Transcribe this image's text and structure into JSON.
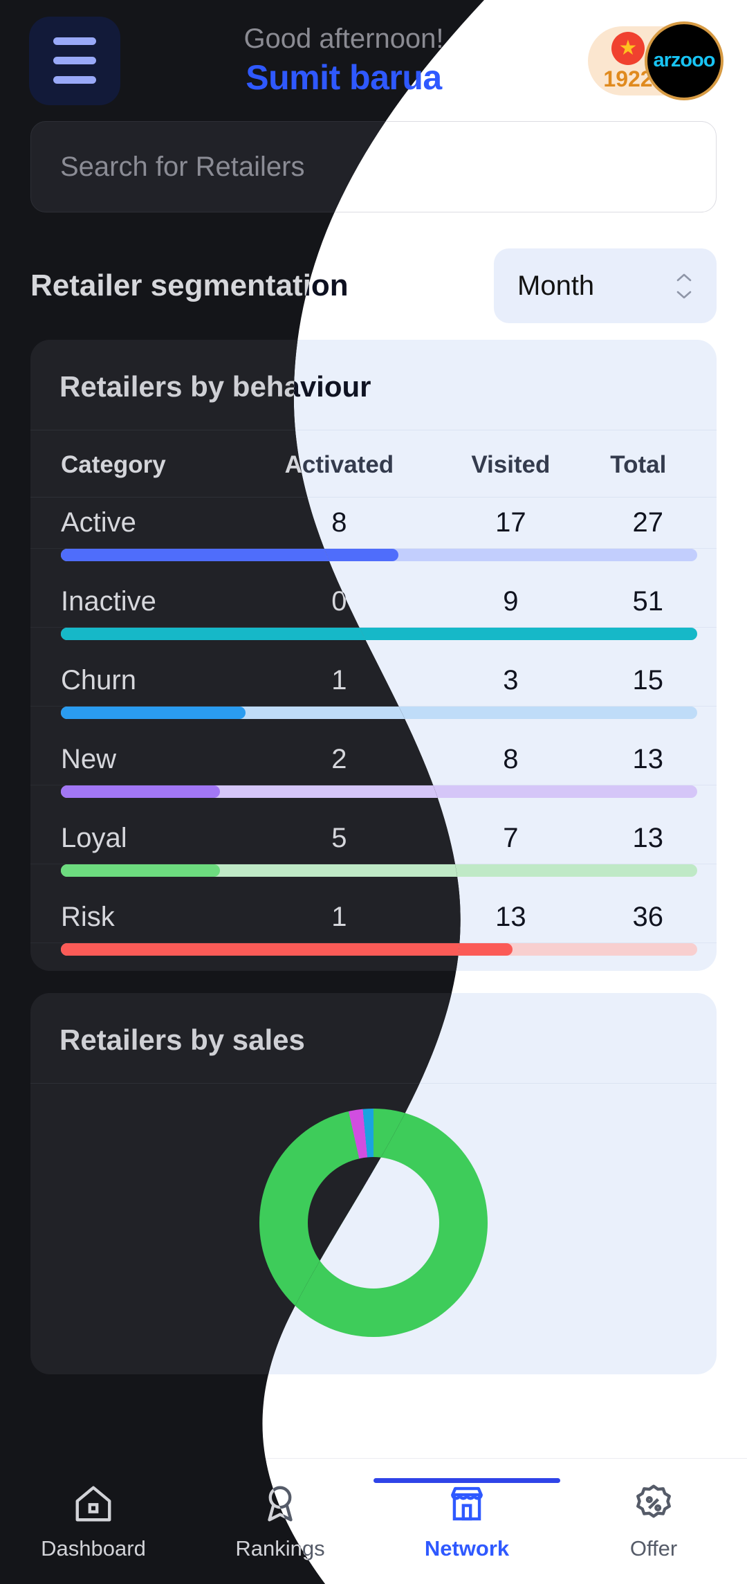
{
  "header": {
    "menu_icon": "hamburger-menu-icon",
    "greeting": "Good afternoon!",
    "user_name": "Sumit barua",
    "points": "1922",
    "star_icon": "star-icon",
    "avatar_text": "arzooo"
  },
  "search": {
    "placeholder": "Search for Retailers",
    "value": ""
  },
  "section": {
    "title": "Retailer segmentation",
    "period_selected": "Month",
    "period_icon": "chevron-up-down-icon"
  },
  "behaviour_card": {
    "title": "Retailers by behaviour"
  },
  "sales_card": {
    "title": "Retailers by sales"
  },
  "chart_data": [
    {
      "type": "table",
      "title": "Retailers by behaviour",
      "columns": [
        "Category",
        "Activated",
        "Visited",
        "Total"
      ],
      "rows": [
        {
          "category": "Active",
          "activated": 8,
          "visited": 17,
          "total": 27,
          "color": "#4f6dfb",
          "track": "#c2cefd"
        },
        {
          "category": "Inactive",
          "activated": 0,
          "visited": 9,
          "total": 51,
          "color": "#16b8c8",
          "track": "#b8e6ef"
        },
        {
          "category": "Churn",
          "activated": 1,
          "visited": 3,
          "total": 15,
          "color": "#2a9cf0",
          "track": "#bfdcf8"
        },
        {
          "category": "New",
          "activated": 2,
          "visited": 8,
          "total": 13,
          "color": "#a277f5",
          "track": "#d5c6f8"
        },
        {
          "category": "Loyal",
          "activated": 5,
          "visited": 7,
          "total": 13,
          "color": "#6ddc7f",
          "track": "#bfe9c6"
        },
        {
          "category": "Risk",
          "activated": 1,
          "visited": 13,
          "total": 36,
          "color": "#fb5b57",
          "track": "#f8cfcf"
        }
      ],
      "xlabel": "",
      "ylabel": ""
    },
    {
      "type": "pie",
      "title": "Retailers by sales",
      "labels": [
        "Green segment",
        "Magenta segment",
        "Cyan segment"
      ],
      "values": [
        96.5,
        2,
        1.5
      ],
      "colors": [
        "#3ecc5a",
        "#d14ee0",
        "#1aa3e0"
      ],
      "donut": true
    }
  ],
  "bottom_nav": {
    "items": [
      {
        "label": "Dashboard",
        "icon": "home-icon",
        "active": false
      },
      {
        "label": "Rankings",
        "icon": "medal-icon",
        "active": false
      },
      {
        "label": "Network",
        "icon": "store-icon",
        "active": true
      },
      {
        "label": "Offer",
        "icon": "discount-icon",
        "active": false
      }
    ]
  },
  "colors": {
    "accent_blue": "#2f59ff",
    "dark_bg": "#141519",
    "dark_card": "#212227",
    "light_card": "#eaf0fb",
    "badge_bg": "#fbe6cf"
  }
}
